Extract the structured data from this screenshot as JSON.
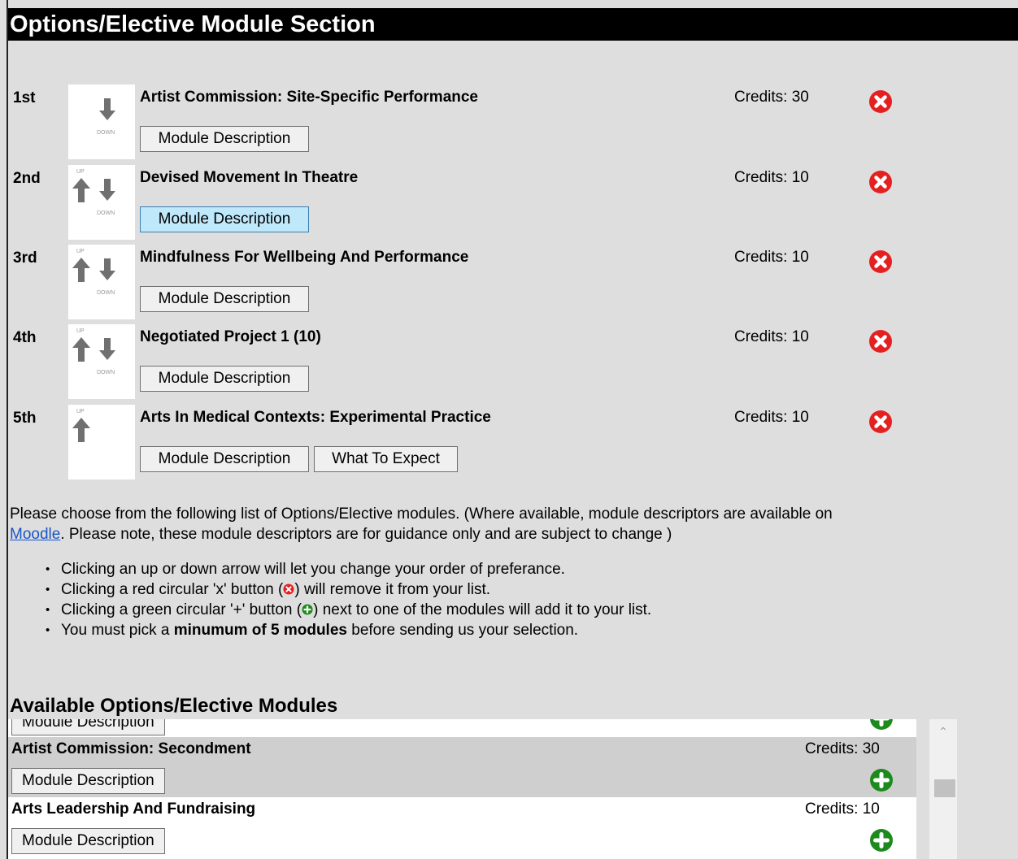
{
  "header": {
    "title": "Options/Elective Module Section"
  },
  "arrow_labels": {
    "up": "UP",
    "down": "DOWN"
  },
  "selected_modules": [
    {
      "position": "1st",
      "title": "Artist Commission: Site-Specific Performance",
      "credits": "Credits: 30",
      "buttons": [
        "Module Description"
      ]
    },
    {
      "position": "2nd",
      "title": "Devised Movement In Theatre",
      "credits": "Credits: 10",
      "buttons": [
        "Module Description"
      ]
    },
    {
      "position": "3rd",
      "title": "Mindfulness For Wellbeing And Performance",
      "credits": "Credits: 10",
      "buttons": [
        "Module Description"
      ]
    },
    {
      "position": "4th",
      "title": "Negotiated Project 1 (10)",
      "credits": "Credits: 10",
      "buttons": [
        "Module Description"
      ]
    },
    {
      "position": "5th",
      "title": "Arts In Medical Contexts: Experimental Practice",
      "credits": "Credits: 10",
      "buttons": [
        "Module Description",
        "What To Expect"
      ]
    }
  ],
  "intro": {
    "text_before": "Please choose from the following list of Options/Elective modules. (Where available, module descriptors are available on",
    "link": "Moodle",
    "text_after": ". Please note, these module descriptors are for guidance only and are subject to change )"
  },
  "bullets": [
    {
      "before": "Clicking an up or down arrow will let you change your order of preferance."
    },
    {
      "before": "Clicking a red circular 'x' button (",
      "after": ") will remove it from your list."
    },
    {
      "before": "Clicking a green circular '+' button (",
      "after": ") next to one of the modules will add it to your list."
    },
    {
      "before": "You must pick a ",
      "bold": "minumum of 5 modules",
      "after": " before sending us your selection."
    }
  ],
  "available": {
    "title": "Available Options/Elective Modules",
    "partial_button": "Module Description",
    "items": [
      {
        "title": "Artist Commission: Secondment",
        "credits": "Credits: 30",
        "button": "Module Description",
        "highlighted": true
      },
      {
        "title": "Arts Leadership And Fundraising",
        "credits": "Credits: 10",
        "button": "Module Description",
        "highlighted": false
      }
    ]
  },
  "colors": {
    "remove": "#e52020",
    "add": "#1d8a1d",
    "row_highlight": "#cfcfcf",
    "link": "#1a55c8"
  },
  "icons": {
    "remove": "close-circle-icon",
    "add": "plus-circle-icon",
    "up": "arrow-up-icon",
    "down": "arrow-down-icon"
  }
}
